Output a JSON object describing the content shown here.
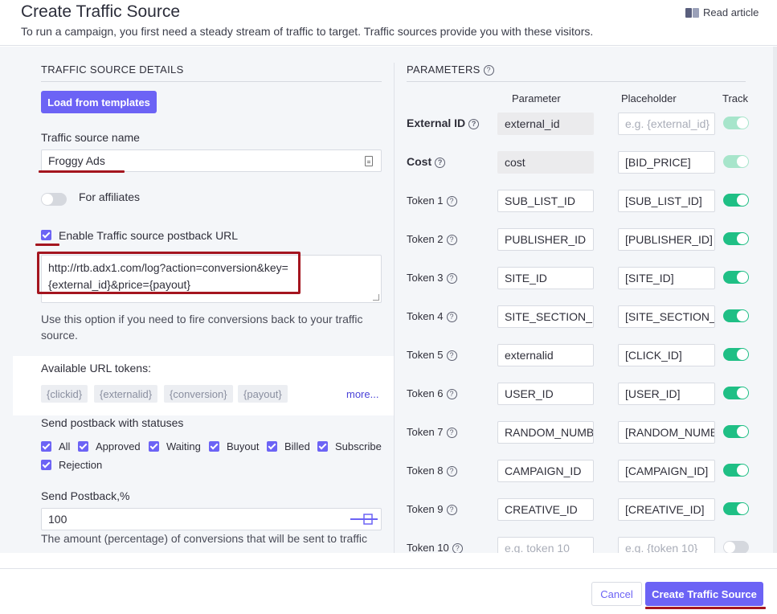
{
  "header": {
    "title": "Create Traffic Source",
    "subtitle": "To run a campaign, you first need a steady stream of traffic to target. Traffic sources provide you with these visitors.",
    "read_article": "Read article"
  },
  "details": {
    "section_title": "TRAFFIC SOURCE DETAILS",
    "load_templates": "Load from templates",
    "name_label": "Traffic source name",
    "name_value": "Froggy Ads",
    "for_affiliates_label": "For affiliates",
    "postback_label": "Enable Traffic source postback URL",
    "postback_url_line1": "http://rtb.adx1.com/log?action=conversion&key=",
    "postback_url_line2": "{external_id}&price={payout}",
    "postback_help_line1": "Use this option if you need to fire conversions back to your traffic",
    "postback_help_line2": "source.",
    "tokens_label": "Available URL tokens:",
    "tokens": [
      "{clickid}",
      "{externalid}",
      "{conversion}",
      "{payout}"
    ],
    "tokens_more": "more...",
    "statuses_label": "Send postback with statuses",
    "statuses": [
      "All",
      "Approved",
      "Waiting",
      "Buyout",
      "Billed",
      "Subscribe",
      "Rejection"
    ],
    "send_postback_label": "Send Postback,%",
    "send_postback_value": "100",
    "send_postback_help": "The amount (percentage) of conversions that will be sent to traffic"
  },
  "parameters": {
    "section_title": "PARAMETERS",
    "col_parameter": "Parameter",
    "col_placeholder": "Placeholder",
    "col_track": "Track",
    "rows": [
      {
        "label": "External ID",
        "parameter": "external_id",
        "placeholder": "e.g. {external_id}",
        "track": "on-light"
      },
      {
        "label": "Cost",
        "parameter": "cost",
        "placeholder": "[BID_PRICE]",
        "track": "on-light"
      },
      {
        "label": "Token 1",
        "parameter": "SUB_LIST_ID",
        "placeholder": "[SUB_LIST_ID]",
        "track": "on"
      },
      {
        "label": "Token 2",
        "parameter": "PUBLISHER_ID",
        "placeholder": "[PUBLISHER_ID]",
        "track": "on"
      },
      {
        "label": "Token 3",
        "parameter": "SITE_ID",
        "placeholder": "[SITE_ID]",
        "track": "on"
      },
      {
        "label": "Token 4",
        "parameter": "SITE_SECTION_ID",
        "placeholder": "[SITE_SECTION_ID]",
        "track": "on"
      },
      {
        "label": "Token 5",
        "parameter": "externalid",
        "placeholder": "[CLICK_ID]",
        "track": "on"
      },
      {
        "label": "Token 6",
        "parameter": "USER_ID",
        "placeholder": "[USER_ID]",
        "track": "on"
      },
      {
        "label": "Token 7",
        "parameter": "RANDOM_NUMBER",
        "placeholder": "[RANDOM_NUMBER]",
        "track": "on"
      },
      {
        "label": "Token 8",
        "parameter": "CAMPAIGN_ID",
        "placeholder": "[CAMPAIGN_ID]",
        "track": "on"
      },
      {
        "label": "Token 9",
        "parameter": "CREATIVE_ID",
        "placeholder": "[CREATIVE_ID]",
        "track": "on"
      },
      {
        "label": "Token 10",
        "parameter": "e.g. token 10",
        "placeholder": "e.g. {token 10}",
        "track": "off"
      }
    ]
  },
  "footer": {
    "cancel": "Cancel",
    "create": "Create Traffic Source"
  }
}
